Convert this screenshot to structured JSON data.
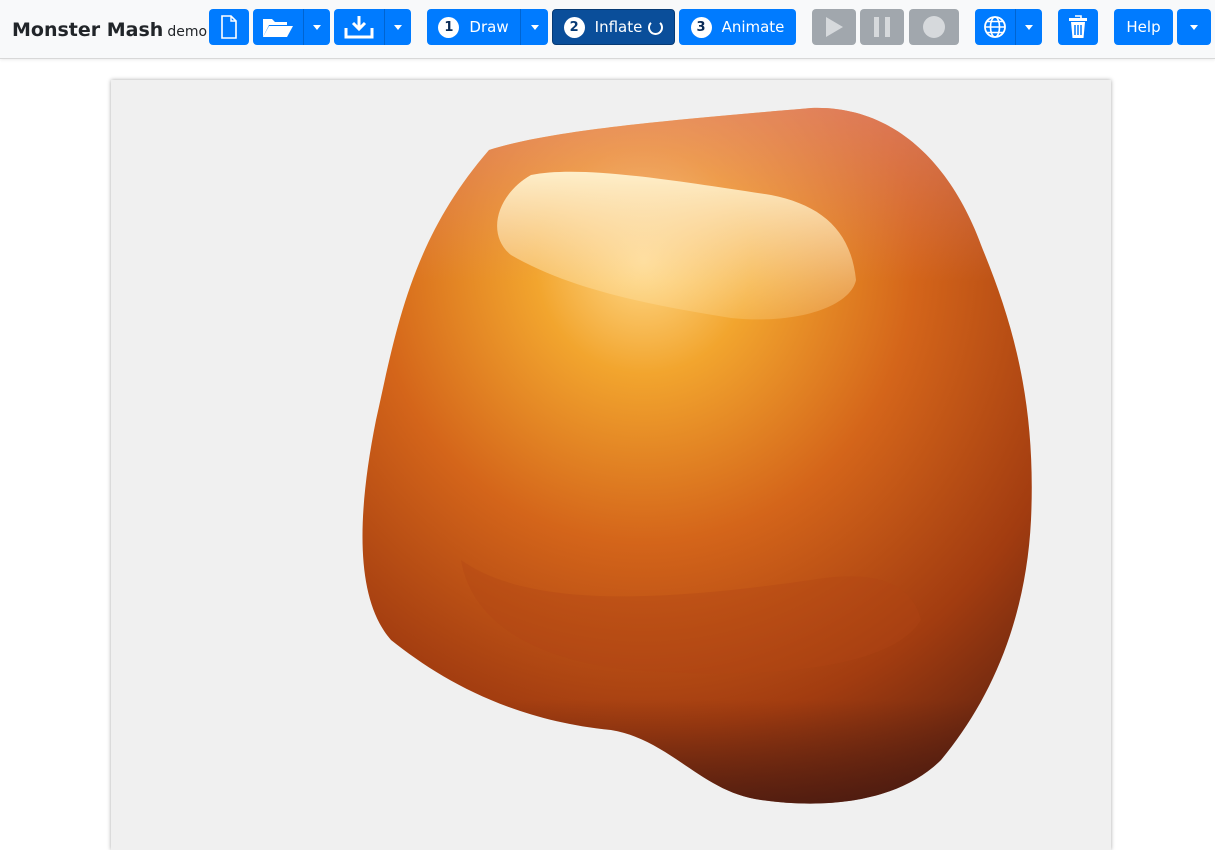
{
  "app": {
    "title": "Monster Mash",
    "subtitle": "demo"
  },
  "toolbar": {
    "file_buttons": [
      {
        "name": "new-file",
        "icon": "file-icon"
      },
      {
        "name": "open-file",
        "icon": "folder-open-icon"
      },
      {
        "name": "save-file",
        "icon": "download-icon"
      }
    ],
    "steps": [
      {
        "number": "1",
        "label": "Draw",
        "active": false
      },
      {
        "number": "2",
        "label": "Inflate",
        "active": true
      },
      {
        "number": "3",
        "label": "Animate",
        "active": false
      }
    ],
    "playback": [
      {
        "name": "play",
        "icon": "play-icon",
        "enabled": false
      },
      {
        "name": "pause",
        "icon": "pause-icon",
        "enabled": false
      },
      {
        "name": "record",
        "icon": "record-icon",
        "enabled": false
      }
    ],
    "language_icon": "globe-icon",
    "delete_icon": "trash-icon",
    "help_label": "Help"
  },
  "colors": {
    "primary": "#007bff",
    "active": "#0a4e9a",
    "disabled": "#a1a7ad",
    "canvas_bg": "#f0f0f0",
    "shape_highlight": "#ffe6a8",
    "shape_mid": "#e7921f",
    "shape_dark": "#7a2a0c"
  }
}
